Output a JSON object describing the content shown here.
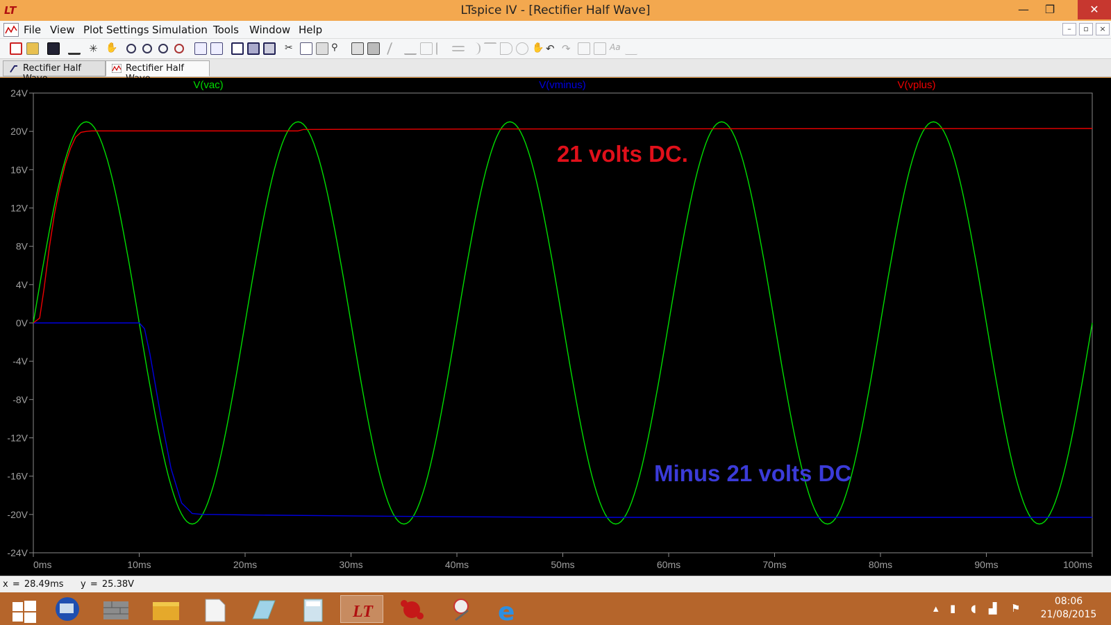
{
  "window": {
    "title": "LTspice IV - [Rectifier Half Wave]",
    "minimize": "—",
    "maximize": "❐",
    "close": "✕"
  },
  "menu": {
    "items": [
      "File",
      "View",
      "Plot Settings",
      "Simulation",
      "Tools",
      "Window",
      "Help"
    ]
  },
  "mdi": {
    "minimize": "–",
    "restore": "▫",
    "close": "×"
  },
  "tabs": [
    {
      "label": "Rectifier Half Wave",
      "icon": "schematic-icon",
      "active": false
    },
    {
      "label": "Rectifier Half Wave",
      "icon": "waveform-icon",
      "active": true
    }
  ],
  "annotations": {
    "dc_positive": {
      "text": "21 volts DC.",
      "color": "#e0101a"
    },
    "dc_negative": {
      "text": "Minus 21 volts DC",
      "color": "#3b3bd8"
    }
  },
  "status": {
    "x_readout": "x = 28.49ms",
    "y_readout": "y = 25.38V"
  },
  "taskbar": {
    "items": [
      "windows-start-icon",
      "remote-desktop-icon",
      "firewall-icon",
      "file-explorer-icon",
      "document-icon",
      "notepad-icon",
      "calculator-icon",
      "ltspice-icon",
      "paint-splat-icon",
      "snipping-tool-icon",
      "internet-explorer-icon"
    ],
    "active_index": 7,
    "clock_time": "08:06",
    "clock_date": "21/08/2015"
  },
  "chart_data": {
    "type": "line",
    "xlabel": "",
    "ylabel": "",
    "xlim": [
      0,
      100
    ],
    "ylim": [
      -24,
      24
    ],
    "x_unit": "ms",
    "y_unit": "V",
    "x_ticks": [
      "0ms",
      "10ms",
      "20ms",
      "30ms",
      "40ms",
      "50ms",
      "60ms",
      "70ms",
      "80ms",
      "90ms",
      "100ms"
    ],
    "y_ticks": [
      "24V",
      "20V",
      "16V",
      "12V",
      "8V",
      "4V",
      "0V",
      "-4V",
      "-8V",
      "-12V",
      "-16V",
      "-20V",
      "-24V"
    ],
    "grid": false,
    "legend": "top",
    "series": [
      {
        "name": "V(vac)",
        "color": "#00dd00",
        "description_values": {
          "amplitude": 21,
          "frequency_hz": 50
        },
        "x": [
          0,
          2.5,
          5,
          7.5,
          10,
          12.5,
          15,
          17.5,
          20,
          22.5,
          25,
          27.5,
          30,
          32.5,
          35,
          37.5,
          40,
          42.5,
          45,
          47.5,
          50,
          52.5,
          55,
          57.5,
          60,
          62.5,
          65,
          67.5,
          70,
          72.5,
          75,
          77.5,
          80,
          82.5,
          85,
          87.5,
          90,
          92.5,
          95,
          97.5,
          100
        ],
        "y": [
          0,
          14.8,
          21,
          14.8,
          0,
          -14.8,
          -21,
          -14.8,
          0,
          14.8,
          21,
          14.8,
          0,
          -14.8,
          -21,
          -14.8,
          0,
          14.8,
          21,
          14.8,
          0,
          -14.8,
          -21,
          -14.8,
          0,
          14.8,
          21,
          14.8,
          0,
          -14.8,
          -21,
          -14.8,
          0,
          14.8,
          21,
          14.8,
          0,
          -14.8,
          -21,
          -14.8,
          0
        ]
      },
      {
        "name": "V(vminus)",
        "color": "#0000e0",
        "x": [
          0,
          10,
          10.5,
          11,
          12,
          13,
          14,
          15,
          16,
          17,
          20,
          35,
          50,
          100
        ],
        "y": [
          0,
          0,
          -0.6,
          -3.2,
          -9.5,
          -15.2,
          -18.8,
          -19.9,
          -20,
          -20,
          -20.05,
          -20.2,
          -20.3,
          -20.3
        ]
      },
      {
        "name": "V(vplus)",
        "color": "#ee0000",
        "x": [
          0,
          0.6,
          1,
          1.5,
          2,
          2.5,
          3,
          3.5,
          4,
          4.5,
          5,
          5.5,
          6,
          25,
          25.5,
          45,
          100
        ],
        "y": [
          0,
          0.5,
          3.5,
          7.8,
          11.4,
          14.2,
          16.5,
          18.2,
          19.4,
          19.9,
          20,
          20.05,
          20.05,
          20.05,
          20.2,
          20.25,
          20.3
        ]
      }
    ]
  }
}
